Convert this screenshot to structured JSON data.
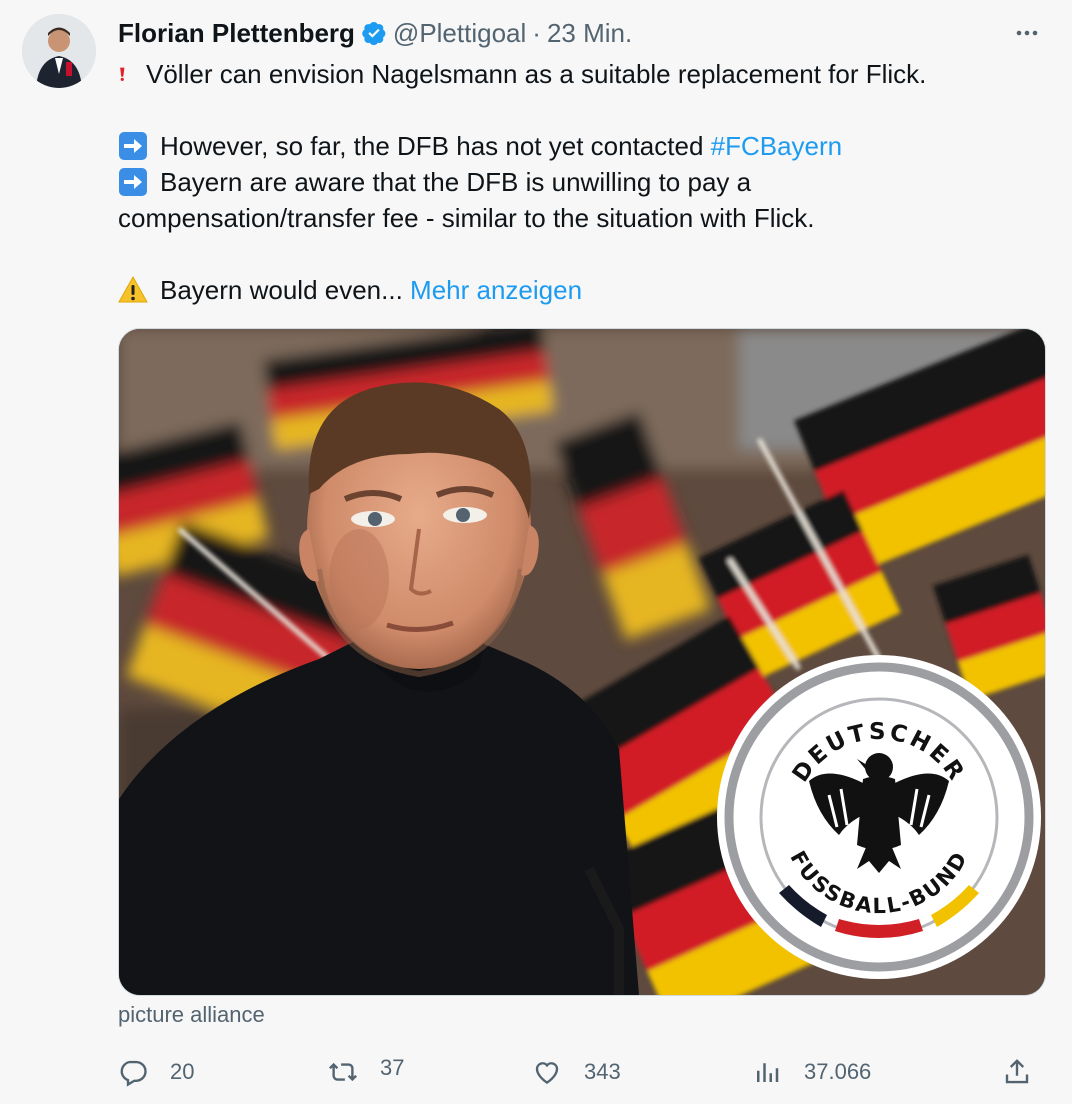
{
  "author": {
    "name": "Florian Plettenberg",
    "handle": "@Plettigoal",
    "separator": "·",
    "time": "23 Min."
  },
  "tweet": {
    "line1": "Völler can envision Nagelsmann as a suitable replacement for Flick.",
    "line2_text": "However, so far, the DFB has not yet contacted ",
    "line2_hashtag": "#FCBayern",
    "line3": "Bayern are aware that the DFB is unwilling to pay a",
    "line4": "compensation/transfer fee - similar to the situation with Flick.",
    "line5_text": "Bayern would even... ",
    "line5_more": "Mehr anzeigen"
  },
  "media": {
    "caption": "picture alliance",
    "logo_top_text": "DEUTSCHER",
    "logo_bottom_text": "FUSSBALL-BUND"
  },
  "actions": {
    "replies": "20",
    "retweets": "37",
    "likes": "343",
    "views": "37.066"
  },
  "colors": {
    "accent": "#1d9bf0",
    "secondary_text": "#536471",
    "flag_black": "#111111",
    "flag_red": "#d11f26",
    "flag_gold": "#f2c200"
  },
  "icons": [
    "more-icon",
    "verified-badge-icon",
    "exclamation-icon",
    "arrow-right-icon",
    "warning-icon",
    "reply-icon",
    "retweet-icon",
    "like-icon",
    "views-icon",
    "share-icon"
  ]
}
